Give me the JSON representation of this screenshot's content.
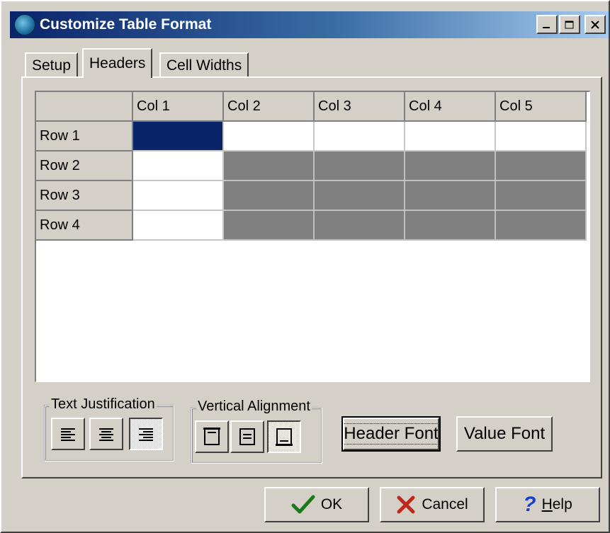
{
  "window": {
    "title": "Customize Table Format",
    "controls": [
      "minimize-icon",
      "maximize-icon",
      "close-icon"
    ]
  },
  "tabs": [
    {
      "label": "Setup",
      "active": false
    },
    {
      "label": "Headers",
      "active": true
    },
    {
      "label": "Cell Widths",
      "active": false
    }
  ],
  "grid": {
    "columns": [
      "Col 1",
      "Col 2",
      "Col 3",
      "Col 4",
      "Col 5"
    ],
    "rows": [
      "Row 1",
      "Row 2",
      "Row 3",
      "Row 4"
    ],
    "selected_color": "#0a246a",
    "disabled_color": "#808080"
  },
  "text_justification": {
    "label": "Text Justification",
    "buttons": [
      "align-left-icon",
      "align-center-icon",
      "align-right-icon"
    ],
    "pressed": "align-right-icon"
  },
  "vertical_alignment": {
    "label": "Vertical Alignment",
    "buttons": [
      "valign-top-icon",
      "valign-center-icon",
      "valign-bottom-icon"
    ],
    "pressed": "valign-bottom-icon"
  },
  "font_buttons": {
    "header_font": "Header Font",
    "value_font": "Value Font"
  },
  "footer": {
    "ok": "OK",
    "cancel": "Cancel",
    "help_prefix": "H",
    "help_rest": "elp"
  },
  "colors": {
    "ok_check": "#1a7a1a",
    "cancel_x": "#c0281c",
    "help_q": "#1c3fd0"
  }
}
